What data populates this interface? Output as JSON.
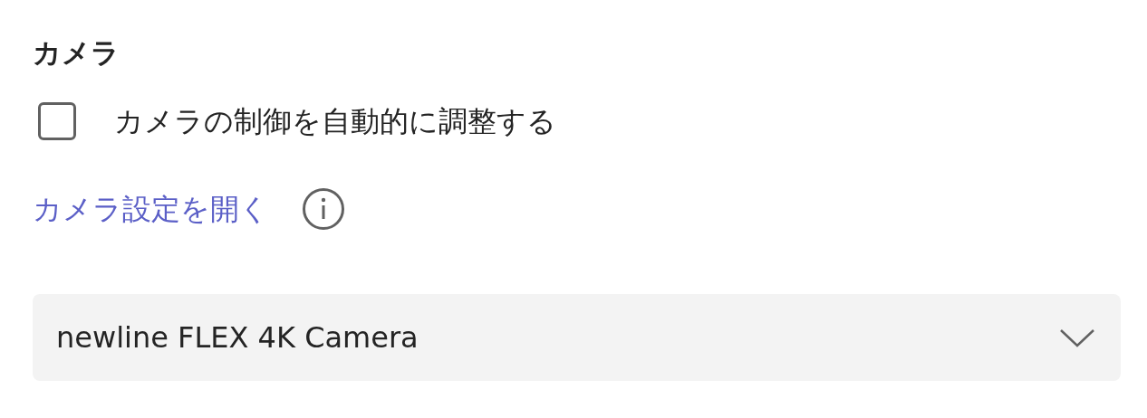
{
  "section_title": "カメラ",
  "checkbox": {
    "label": "カメラの制御を自動的に調整する",
    "checked": false
  },
  "link": {
    "label": "カメラ設定を開く"
  },
  "dropdown": {
    "value": "newline FLEX 4K Camera"
  }
}
